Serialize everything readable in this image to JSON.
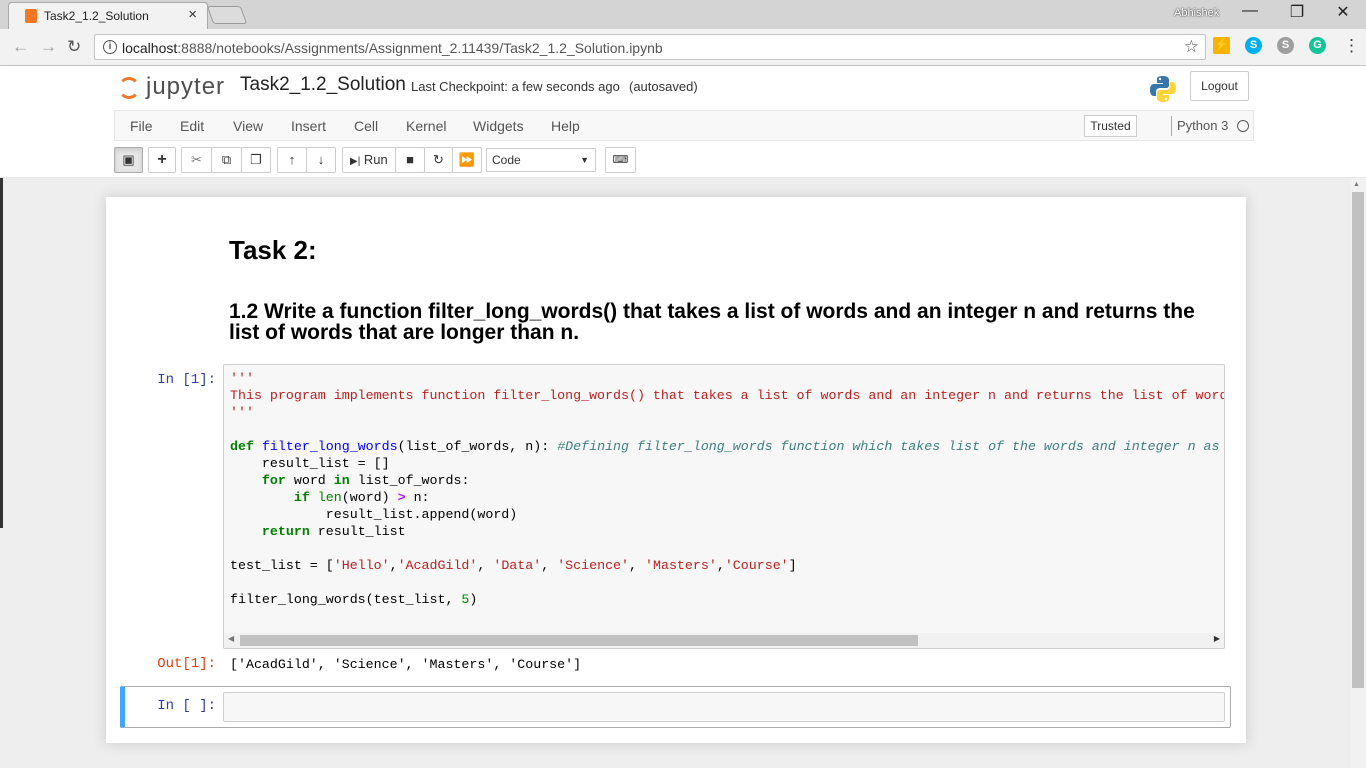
{
  "browser": {
    "tab_title": "Task2_1.2_Solution",
    "tab_close": "×",
    "profile_name": "Abhishek",
    "window_controls": {
      "minimize": "—",
      "restore": "❐",
      "close": "✕"
    },
    "url_host": "localhost",
    "url_rest": ":8888/notebooks/Assignments/Assignment_2.11439/Task2_1.2_Solution.ipynb",
    "extensions": [
      {
        "name": "lightning-extension-icon",
        "color": "#f4b400"
      },
      {
        "name": "skype-icon",
        "color": "#00aff0"
      },
      {
        "name": "skype-alt-icon",
        "color": "#9e9e9e"
      },
      {
        "name": "grammarly-icon",
        "color": "#15c39a"
      }
    ]
  },
  "jupyter": {
    "logo_text": "jupyter",
    "notebook_title": "Task2_1.2_Solution",
    "checkpoint": "Last Checkpoint: a few seconds ago",
    "autosave": "(autosaved)",
    "logout_label": "Logout",
    "menu": [
      "File",
      "Edit",
      "View",
      "Insert",
      "Cell",
      "Kernel",
      "Widgets",
      "Help"
    ],
    "trusted_label": "Trusted",
    "kernel_name": "Python 3",
    "toolbar": {
      "run_label": "Run",
      "cell_type": "Code",
      "icons": [
        "save-icon",
        "plus-icon",
        "cut-icon",
        "copy-icon",
        "paste-icon",
        "arrow-up-icon",
        "arrow-down-icon",
        "run-icon",
        "stop-icon",
        "restart-icon",
        "fast-forward-icon",
        "keyboard-icon"
      ]
    }
  },
  "notebook": {
    "heading1": "Task 2:",
    "heading2": "1.2 Write a function filter_long_words() that takes a list of words and an integer n and returns the list of words that are longer than n.",
    "cell1": {
      "in_prompt": "In [1]:",
      "out_prompt": "Out[1]:",
      "output": "['AcadGild', 'Science', 'Masters', 'Course']"
    },
    "cell2": {
      "in_prompt": "In [ ]:"
    }
  }
}
